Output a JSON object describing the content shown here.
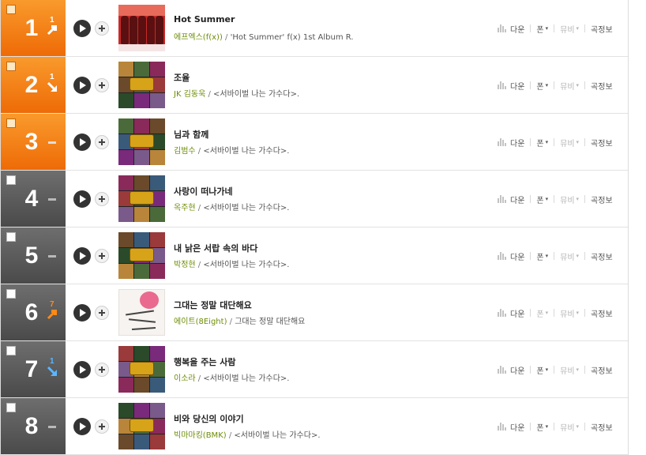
{
  "actions": {
    "download_label": "다운",
    "phone_label": "폰",
    "mv_label": "뮤비",
    "info_label": "곡정보",
    "dropdown_arrow": "▾",
    "slash": "/"
  },
  "colors": {
    "top_rank_bg": "#f08117",
    "rank_bg": "#555555",
    "artist_link": "#6d8d05",
    "rank_up": "#ff8a16",
    "rank_down": "#5bb6ff"
  },
  "rows": [
    {
      "rank": "1",
      "change": "1",
      "change_dir": "up",
      "title": "Hot Summer",
      "artist": "에프엑스(f(x))",
      "album": "'Hot Summer' f(x) 1st Album R.",
      "art": "summer",
      "phone_active": true,
      "mv_active": false
    },
    {
      "rank": "2",
      "change": "1",
      "change_dir": "down",
      "title": "조율",
      "artist": "JK 김동욱",
      "album": "<서바이벌 나는 가수다>.",
      "art": "grid",
      "phone_active": true,
      "mv_active": false
    },
    {
      "rank": "3",
      "change": "",
      "change_dir": "same",
      "title": "님과 함께",
      "artist": "김범수",
      "album": "<서바이벌 나는 가수다>.",
      "art": "grid",
      "phone_active": true,
      "mv_active": false
    },
    {
      "rank": "4",
      "change": "",
      "change_dir": "same",
      "title": "사랑이 떠나가네",
      "artist": "옥주현",
      "album": "<서바이벌 나는 가수다>.",
      "art": "grid",
      "phone_active": true,
      "mv_active": false
    },
    {
      "rank": "5",
      "change": "",
      "change_dir": "same",
      "title": "내 낡은 서랍 속의 바다",
      "artist": "박정현",
      "album": "<서바이벌 나는 가수다>.",
      "art": "grid",
      "phone_active": true,
      "mv_active": false
    },
    {
      "rank": "6",
      "change": "7",
      "change_dir": "up",
      "title": "그대는 정말 대단해요",
      "artist": "에이트(8Eight)",
      "album": "그대는 정말 대단해요",
      "art": "eight",
      "phone_active": false,
      "mv_active": false
    },
    {
      "rank": "7",
      "change": "1",
      "change_dir": "down",
      "title": "행복을 주는 사람",
      "artist": "이소라",
      "album": "<서바이벌 나는 가수다>.",
      "art": "grid",
      "phone_active": true,
      "mv_active": false
    },
    {
      "rank": "8",
      "change": "",
      "change_dir": "same",
      "title": "비와 당신의 이야기",
      "artist": "빅마마킹(BMK)",
      "album": "<서바이벌 나는 가수다>.",
      "art": "grid",
      "phone_active": true,
      "mv_active": false
    }
  ]
}
